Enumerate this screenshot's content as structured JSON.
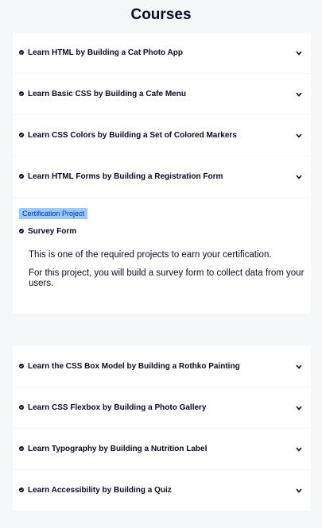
{
  "page": {
    "title": "Courses"
  },
  "courses_top": [
    {
      "label": "Learn HTML by Building a Cat Photo App"
    },
    {
      "label": "Learn Basic CSS by Building a Cafe Menu"
    },
    {
      "label": "Learn CSS Colors by Building a Set of Colored Markers"
    },
    {
      "label": "Learn HTML Forms by Building a Registration Form"
    }
  ],
  "certification": {
    "badge": "Certification Project",
    "project_title": "Survey Form",
    "description_1": "This is one of the required projects to earn your certification.",
    "description_2": "For this project, you will build a survey form to collect data from your users."
  },
  "courses_bottom": [
    {
      "label": "Learn the CSS Box Model by Building a Rothko Painting"
    },
    {
      "label": "Learn CSS Flexbox by Building a Photo Gallery"
    },
    {
      "label": "Learn Typography by Building a Nutrition Label"
    },
    {
      "label": "Learn Accessibility by Building a Quiz"
    }
  ],
  "icons": {
    "completed": "check-circle-icon",
    "expand": "chevron-down-icon"
  },
  "colors": {
    "badge_bg": "#99c9ff",
    "badge_text": "#002ead",
    "text": "#0a0a23",
    "background": "#f5f6f7"
  }
}
